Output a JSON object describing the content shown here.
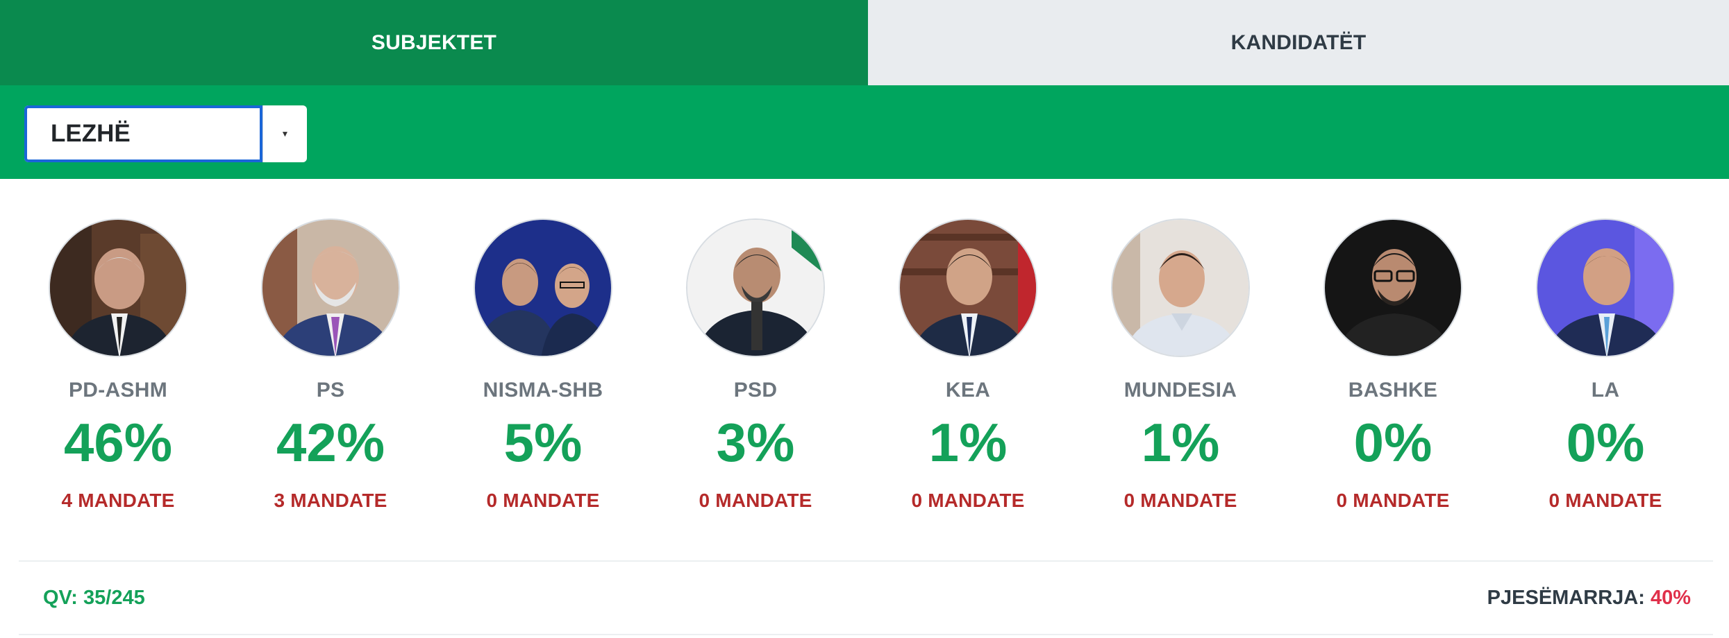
{
  "tabs": [
    {
      "label": "SUBJEKTET",
      "active": true
    },
    {
      "label": "KANDIDATËT",
      "active": false
    }
  ],
  "filter": {
    "selected": "LEZHË",
    "arrow_icon": "caret-down-icon"
  },
  "parties": [
    {
      "id": "pd-ashm",
      "name": "PD-ASHM",
      "percent": "46%",
      "seats": "4 MANDATE",
      "photo_bg": "#5a3b2a"
    },
    {
      "id": "ps",
      "name": "PS",
      "percent": "42%",
      "seats": "3 MANDATE",
      "photo_bg": "#c9b7a6"
    },
    {
      "id": "nisma-shb",
      "name": "NISMA-SHB",
      "percent": "5%",
      "seats": "0 MANDATE",
      "photo_bg": "#1d2f8a"
    },
    {
      "id": "psd",
      "name": "PSD",
      "percent": "3%",
      "seats": "0 MANDATE",
      "photo_bg": "#f2f2f2"
    },
    {
      "id": "kea",
      "name": "KEA",
      "percent": "1%",
      "seats": "0 MANDATE",
      "photo_bg": "#7a4a3a"
    },
    {
      "id": "mundesia",
      "name": "MUNDESIA",
      "percent": "1%",
      "seats": "0 MANDATE",
      "photo_bg": "#e6e1dc"
    },
    {
      "id": "bashke",
      "name": "BASHKE",
      "percent": "0%",
      "seats": "0 MANDATE",
      "photo_bg": "#151515"
    },
    {
      "id": "la",
      "name": "LA",
      "percent": "0%",
      "seats": "0 MANDATE",
      "photo_bg": "#5b56e0"
    }
  ],
  "footer": {
    "qv": "QV: 35/245",
    "turnout_label": "PJESËMARRJA:",
    "turnout_value": "40%"
  },
  "colors": {
    "tab_active": "#0a8a4e",
    "filter_bar": "#00a55e",
    "percent_green": "#14a159",
    "seats_red": "#b52a2a",
    "turnout_red": "#e0304a"
  }
}
